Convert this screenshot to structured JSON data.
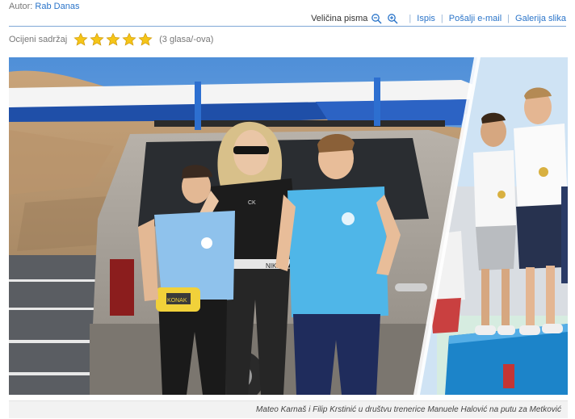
{
  "author": {
    "prefix": "Autor:",
    "name": "Rab Danas"
  },
  "toolbar": {
    "font_size_label": "Veličina pisma",
    "print": "Ispis",
    "email": "Pošalji e-mail",
    "gallery": "Galerija slika"
  },
  "rating": {
    "label": "Ocijeni sadržaj",
    "stars": 5,
    "votes": "(3 glasa/-ova)"
  },
  "photo": {
    "caption": "Mateo Karnaš i Filip Krstinić u društvu trenerice Manuele Halović na putu za Metković",
    "sign_text": "KONAK",
    "belt_text": "NIKE",
    "cap_text": "CK"
  },
  "colors": {
    "link": "#2a74c9",
    "rule": "#7fa7d6",
    "star": "#f5c518"
  }
}
